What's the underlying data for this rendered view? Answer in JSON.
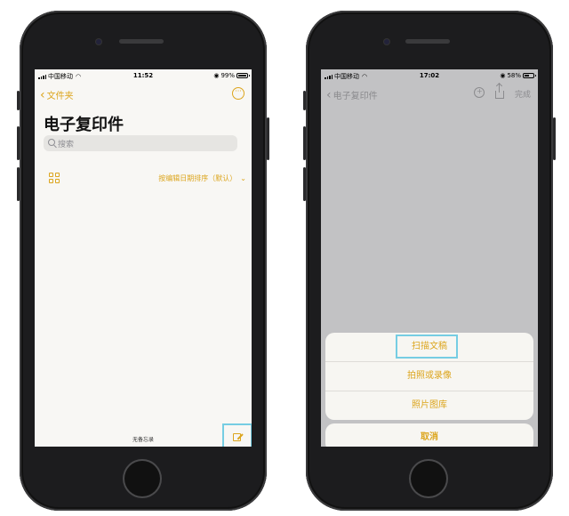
{
  "left_phone": {
    "status": {
      "carrier": "中国移动",
      "time": "11:52",
      "battery": "99%",
      "battery_level": 0.99
    },
    "nav": {
      "back_label": "文件夹",
      "more_icon": "ellipsis-circle-icon"
    },
    "title": "电子复印件",
    "search": {
      "placeholder": "搜索"
    },
    "view_toggle_icon": "grid-icon",
    "sort_label": "按编辑日期排序（默认）",
    "empty_label": "无备忘录",
    "compose_icon": "compose-icon"
  },
  "right_phone": {
    "status": {
      "carrier": "中国移动",
      "time": "17:02",
      "battery": "58%",
      "battery_level": 0.58
    },
    "nav": {
      "back_label": "电子复印件",
      "done_label": "完成"
    },
    "sheet_options": [
      "扫描文稿",
      "拍照或录像",
      "照片图库"
    ],
    "cancel_label": "取消"
  },
  "colors": {
    "accent": "#dca51d",
    "highlight": "#76cde3"
  }
}
